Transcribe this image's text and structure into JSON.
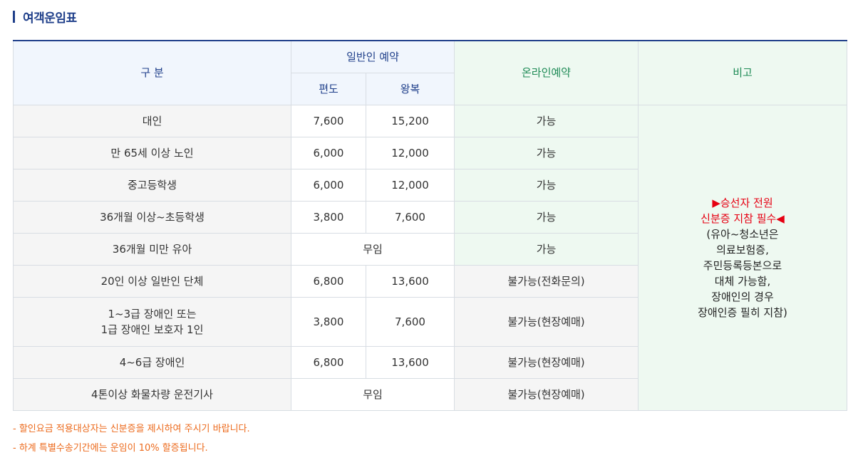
{
  "section_title": "여객운임표",
  "table": {
    "headers": {
      "category": "구 분",
      "general": "일반인 예약",
      "oneway": "편도",
      "round": "왕복",
      "online": "온라인예약",
      "note": "비고"
    },
    "rows": [
      {
        "category": "대인",
        "oneway": "7,600",
        "round": "15,200",
        "online": "가능"
      },
      {
        "category": "만 65세 이상 노인",
        "oneway": "6,000",
        "round": "12,000",
        "online": "가능"
      },
      {
        "category": "중고등학생",
        "oneway": "6,000",
        "round": "12,000",
        "online": "가능"
      },
      {
        "category": "36개월 이상~초등학생",
        "oneway": "3,800",
        "round": "7,600",
        "online": "가능"
      },
      {
        "category": "36개월 미만 유아",
        "free": "무임",
        "online": "가능"
      },
      {
        "category": "20인 이상 일반인 단체",
        "oneway": "6,800",
        "round": "13,600",
        "online": "불가능(전화문의)"
      },
      {
        "category_line1": "1~3급 장애인 또는",
        "category_line2": "1급 장애인 보호자 1인",
        "oneway": "3,800",
        "round": "7,600",
        "online": "불가능(현장예매)"
      },
      {
        "category": "4~6급 장애인",
        "oneway": "6,800",
        "round": "13,600",
        "online": "불가능(현장예매)"
      },
      {
        "category": "4톤이상 화물차량 운전기사",
        "free": "무임",
        "online": "불가능(현장예매)"
      }
    ],
    "note_lines": [
      "▶승선자 전원",
      "신분증 지참 필수◀",
      "(유아~청소년은",
      "의료보험증,",
      "주민등록등본으로",
      "대체 가능함,",
      "장애인의 경우",
      "장애인증 필히 지참)"
    ]
  },
  "footnotes": [
    "- 할인요금 적용대상자는 신분증을 제시하여 주시기 바랍니다.",
    "- 하계 특별수송기간에는 운임이 10% 할증됩니다."
  ],
  "colors": {
    "navy": "#1f3f8a",
    "green": "#1d8a55",
    "red": "#e60012",
    "orange": "#ec6a1c"
  }
}
